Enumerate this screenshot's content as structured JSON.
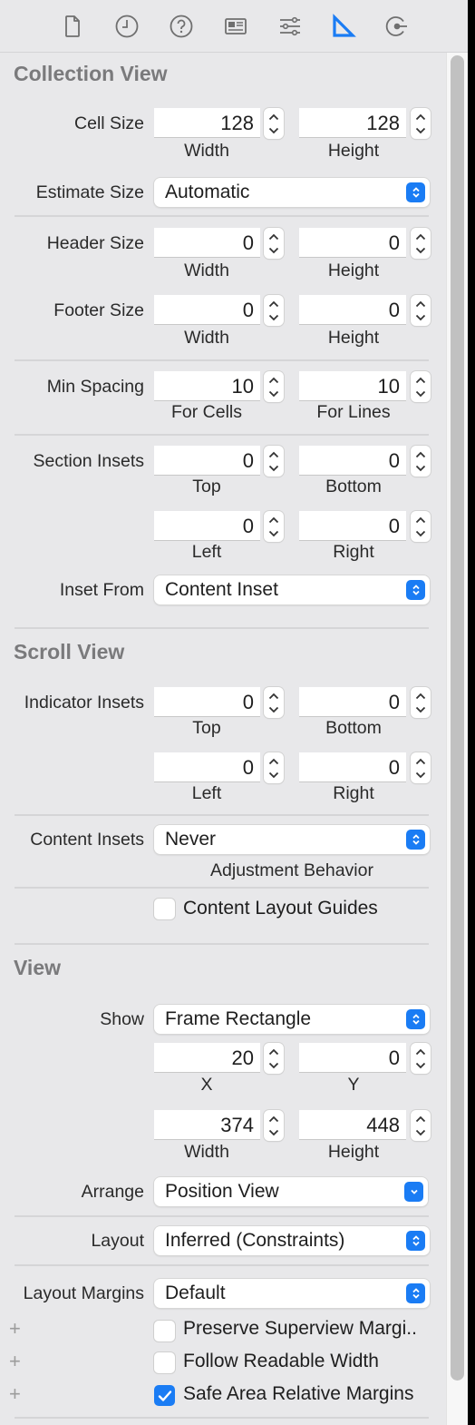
{
  "toolbar": {
    "icons": [
      {
        "name": "file-inspector",
        "active": false
      },
      {
        "name": "history-inspector",
        "active": false
      },
      {
        "name": "quick-help-inspector",
        "active": false
      },
      {
        "name": "identity-inspector",
        "active": false
      },
      {
        "name": "attributes-inspector",
        "active": false
      },
      {
        "name": "size-inspector",
        "active": true
      },
      {
        "name": "connections-inspector",
        "active": false
      }
    ],
    "accent_color": "#1a7cf4"
  },
  "collection_view": {
    "title": "Collection View",
    "cell_size": {
      "label": "Cell Size",
      "width": "128",
      "height": "128",
      "width_label": "Width",
      "height_label": "Height"
    },
    "estimate_size": {
      "label": "Estimate Size",
      "value": "Automatic"
    },
    "header_size": {
      "label": "Header Size",
      "width": "0",
      "height": "0",
      "width_label": "Width",
      "height_label": "Height"
    },
    "footer_size": {
      "label": "Footer Size",
      "width": "0",
      "height": "0",
      "width_label": "Width",
      "height_label": "Height"
    },
    "min_spacing": {
      "label": "Min Spacing",
      "cells": "10",
      "lines": "10",
      "cells_label": "For Cells",
      "lines_label": "For Lines"
    },
    "section_insets": {
      "label": "Section Insets",
      "top": "0",
      "bottom": "0",
      "left": "0",
      "right": "0",
      "top_label": "Top",
      "bottom_label": "Bottom",
      "left_label": "Left",
      "right_label": "Right"
    },
    "inset_from": {
      "label": "Inset From",
      "value": "Content Inset"
    }
  },
  "scroll_view": {
    "title": "Scroll View",
    "indicator_insets": {
      "label": "Indicator Insets",
      "top": "0",
      "bottom": "0",
      "left": "0",
      "right": "0",
      "top_label": "Top",
      "bottom_label": "Bottom",
      "left_label": "Left",
      "right_label": "Right"
    },
    "content_insets": {
      "label": "Content Insets",
      "value": "Never",
      "sub_label": "Adjustment Behavior"
    },
    "content_layout_guides": {
      "label": "Content Layout Guides",
      "checked": false
    }
  },
  "view": {
    "title": "View",
    "show": {
      "label": "Show",
      "value": "Frame Rectangle"
    },
    "frame": {
      "x": "20",
      "y": "0",
      "width": "374",
      "height": "448",
      "x_label": "X",
      "y_label": "Y",
      "width_label": "Width",
      "height_label": "Height"
    },
    "arrange": {
      "label": "Arrange",
      "value": "Position View"
    },
    "layout": {
      "label": "Layout",
      "value": "Inferred (Constraints)"
    },
    "layout_margins": {
      "label": "Layout Margins",
      "value": "Default"
    },
    "options": [
      {
        "label": "Preserve Superview Margi..",
        "checked": false
      },
      {
        "label": "Follow Readable Width",
        "checked": false
      },
      {
        "label": "Safe Area Relative Margins",
        "checked": true
      }
    ]
  }
}
